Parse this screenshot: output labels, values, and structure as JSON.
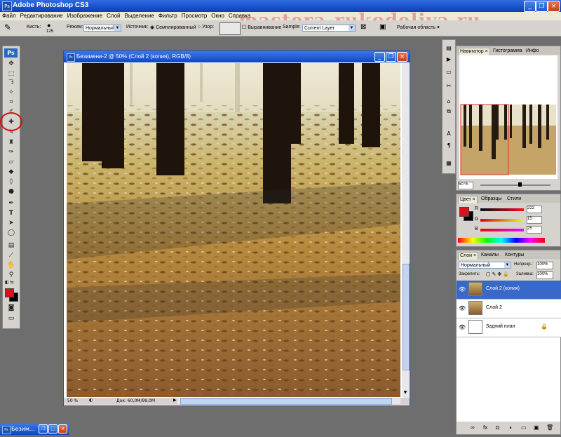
{
  "app": {
    "title": "Adobe Photoshop CS3",
    "icon": "photoshop-app-icon"
  },
  "watermark": "mastera-rukodeliya.ru",
  "menu": [
    "Файл",
    "Редактирование",
    "Изображение",
    "Слой",
    "Выделение",
    "Фильтр",
    "Просмотр",
    "Окно",
    "Справка"
  ],
  "options": {
    "brush_label": "Кисть:",
    "brush_size": "125",
    "mode_label": "Режим:",
    "mode_value": "Нормальный",
    "source_label": "Источник:",
    "sampled_label": "Семплированный",
    "pattern_label": "Узор:",
    "aligned_label": "Выравнивание",
    "sample_label": "Sample:",
    "sample_value": "Current Layer",
    "workspace_label": "Рабочая область"
  },
  "toolbox": {
    "logo": "Ps"
  },
  "document": {
    "title": "Безимени-2 @ 50% (Слой 2 (копия), RGB/8)",
    "zoom": "50 %",
    "doc_info": "Док: 60,0M/99,0M"
  },
  "navigator": {
    "tabs": [
      "Навигатор ×",
      "Гистограмма",
      "Инфо"
    ],
    "zoom": "50 %"
  },
  "color": {
    "tabs": [
      "Цвет ×",
      "Образцы",
      "Стили"
    ],
    "r_label": "R",
    "r_value": "222",
    "g_label": "G",
    "g_value": "15",
    "b_label": "B",
    "b_value": "25",
    "foreground": "#de0f19"
  },
  "layers": {
    "tabs": [
      "Слои ×",
      "Каналы",
      "Контуры"
    ],
    "blend_mode": "Нормальный",
    "opacity_label": "Непрозр.:",
    "opacity_value": "100%",
    "lock_label": "Закрепить:",
    "fill_label": "Заливка:",
    "fill_value": "100%",
    "items": [
      {
        "name": "Слой 2 (копия)",
        "selected": true
      },
      {
        "name": "Слой 2",
        "selected": false
      },
      {
        "name": "Задний план",
        "selected": false
      }
    ]
  },
  "taskbar": {
    "item": "Безим..."
  }
}
